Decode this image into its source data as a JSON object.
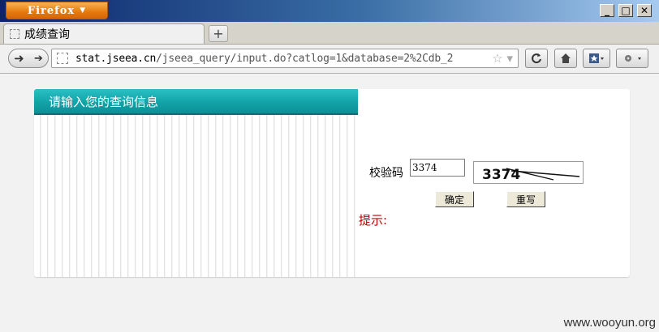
{
  "browser": {
    "app_button": "Firefox",
    "window_controls": [
      "_",
      "□",
      "✕"
    ],
    "tab": {
      "title": "成绩查询"
    },
    "new_tab": "+",
    "url": {
      "host": "stat.jseea.cn",
      "path": "/jseea_query/input.do?catlog=1&database=2%2Cdb_2"
    }
  },
  "page": {
    "header_title": "请输入您的查询信息",
    "code_label": "校验码",
    "code_value": "3374",
    "captcha_text": "3374",
    "submit_label": "确定",
    "reset_label": "重写",
    "hint_label": "提示:"
  },
  "watermark": "www.wooyun.org",
  "colors": {
    "header_teal": "#12a3a8",
    "hint_red": "#c00000",
    "firefox_orange": "#e5790e"
  }
}
